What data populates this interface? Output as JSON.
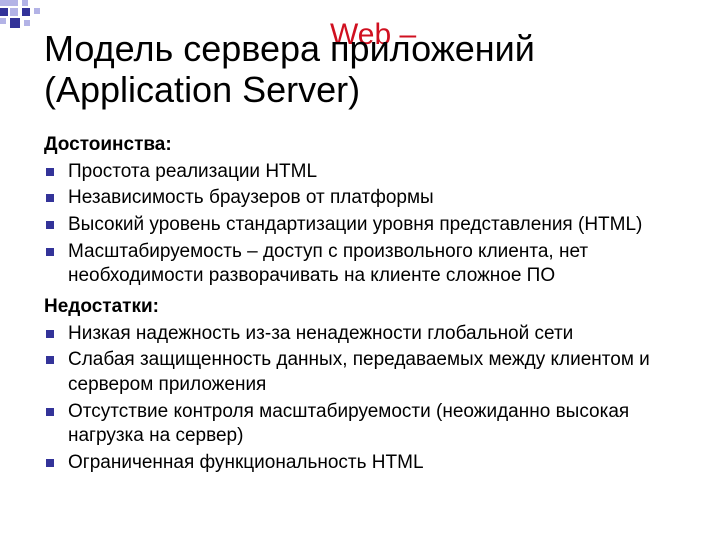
{
  "title_line1": "Модель сервера приложений",
  "title_line2": "(Application Server)",
  "annotation": "Web –",
  "sections": [
    {
      "heading": "Достоинства:",
      "items": [
        "Простота реализации HTML",
        "Независимость браузеров от платформы",
        "Высокий уровень стандартизации уровня представления (HTML)",
        "Масштабируемость – доступ с произвольного клиента, нет необходимости разворачивать на клиенте сложное ПО"
      ]
    },
    {
      "heading": "Недостатки:",
      "items": [
        "Низкая надежность из-за ненадежности глобальной сети",
        "Слабая защищенность данных, передаваемых между клиентом и сервером приложения",
        "Отсутствие контроля масштабируемости (неожиданно высокая нагрузка на сервер)",
        "Ограниченная функциональность HTML"
      ]
    }
  ]
}
